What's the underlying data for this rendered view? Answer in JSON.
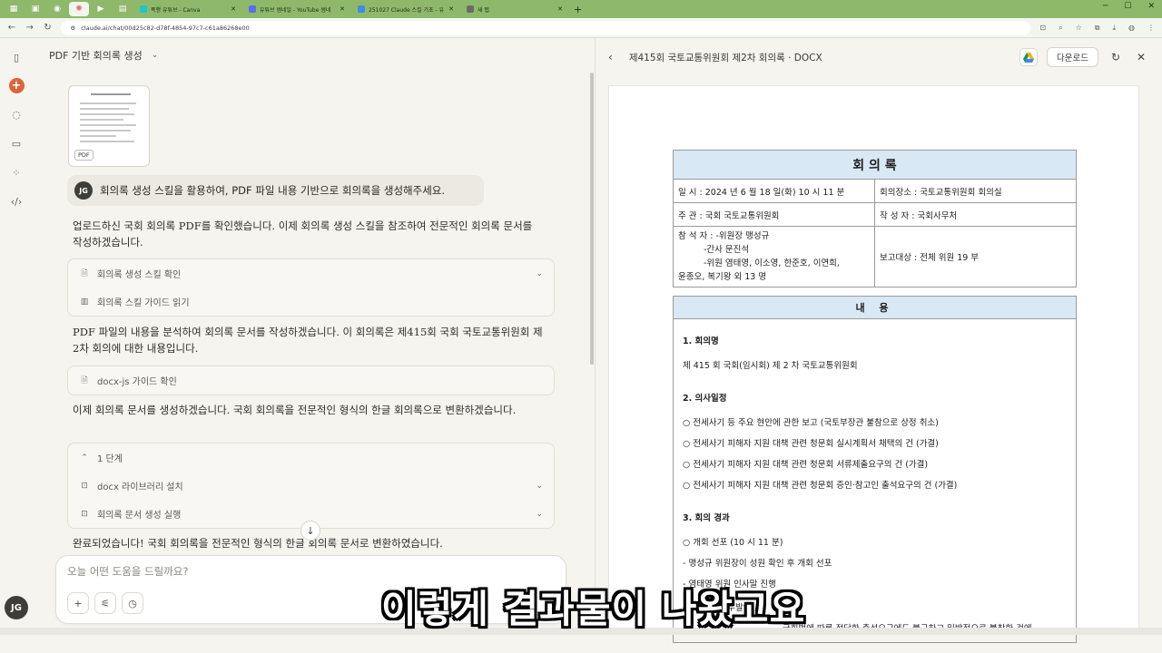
{
  "browser": {
    "tabs": [
      {
        "label": "폭행 유튜브 - Canva",
        "color": "#20c4cb"
      },
      {
        "label": "유튜브 썸네일 - YouTube 썸네",
        "color": "#5b6cf0"
      },
      {
        "label": "251027 Claude 스킬 기초 - 유",
        "color": "#3a8fe0"
      },
      {
        "label": "새 탭",
        "color": "#6b6b6b"
      }
    ],
    "url": "claude.ai/chat/00d25c82-d78f-4854-97c7-c61a86268e00"
  },
  "chat": {
    "title": "PDF 기반 회의록 생성",
    "pdf_badge": "PDF",
    "user_initials": "JG",
    "user_message": "회의록 생성 스킬을 활용하여, PDF 파일 내용 기반으로 회의록을 생성해주세요.",
    "para1": "업로드하신 국회 회의록 PDF를 확인했습니다. 이제 회의록 생성 스킬을 참조하여 전문적인 회의록 문서를 작성하겠습니다.",
    "tools1": [
      {
        "icon": "file-icon",
        "label": "회의록 생성 스킬 확인"
      },
      {
        "icon": "book-icon",
        "label": "회의록 스킬 가이드 읽기"
      }
    ],
    "para2": "PDF 파일의 내용을 분석하여 회의록 문서를 작성하겠습니다. 이 회의록은 제415회 국회 국토교통위원회 제2차 회의에 대한 내용입니다.",
    "tool2": "docx-js 가이드 확인",
    "para3": "이제 회의록 문서를 생성하겠습니다. 국회 회의록을 전문적인 형식의 한글 회의록으로 변환하겠습니다.",
    "step_label": "1 단계",
    "tools3": [
      {
        "label": "docx 라이브러리 설치"
      },
      {
        "label": "회의록 문서 생성 실행"
      }
    ],
    "para4": "완료되었습니다! 국회 회의록을 전문적인 형식의 한글 회의록 문서로 변환하였습니다.",
    "composer_placeholder": "오늘 어떤 도움을 드릴까요?"
  },
  "doc": {
    "title": "제415회 국토교통위원회 제2차 회의록 · DOCX",
    "download_label": "다운로드",
    "heading": "회 의 록",
    "date": "일   시 : 2024 년 6 월 18 일(화) 10 시 11 분",
    "place": "회의장소 : 국토교통위원회 회의실",
    "host": "주   관 : 국회 국토교통위원회",
    "writer": "작 성 자 : 국회사무처",
    "attendees_1": "참 석 자 : -위원장 맹성규",
    "attendees_2": "-간사 문진석",
    "attendees_3": "-위원 염태영, 이소영, 한준호, 이연희,",
    "attendees_4": "윤종오, 복기왕 외 13 명",
    "report_target": "보고대상 : 전체 위원    19 부",
    "content_heading": "내 용",
    "sec1_h": "1. 회의명",
    "sec1_t": "제 415 회 국회(임시회) 제 2 차 국토교통위원회",
    "sec2_h": "2. 의사일정",
    "agenda": [
      "○ 전세사기 등 주요 현안에 관한 보고 (국토부장관 불참으로 상정 취소)",
      "○ 전세사기 피해자 지원 대책 관련 청문회 실시계획서 채택의 건 (가결)",
      "○ 전세사기 피해자 지원 대책 관련 청문회 서류제출요구의 건 (가결)",
      "○ 전세사기 피해자 지원 대책 관련 청문회 증인·참고인 출석요구의 건 (가결)"
    ],
    "sec3_h": "3. 회의 경과",
    "results": [
      "○ 개회 선포 (10 시 11 분)",
      "- 맹성규 위원장이 성원 확인 후 개회 선포",
      "- 염태영 위원 인사말 진행",
      "○ 위원장 모두발언",
      "국회법에 따른 정당한 출석요구에도 불구하고 일방적으로 불참한 것에"
    ]
  },
  "subtitle": "이렇게 결과물이 나왔고요"
}
